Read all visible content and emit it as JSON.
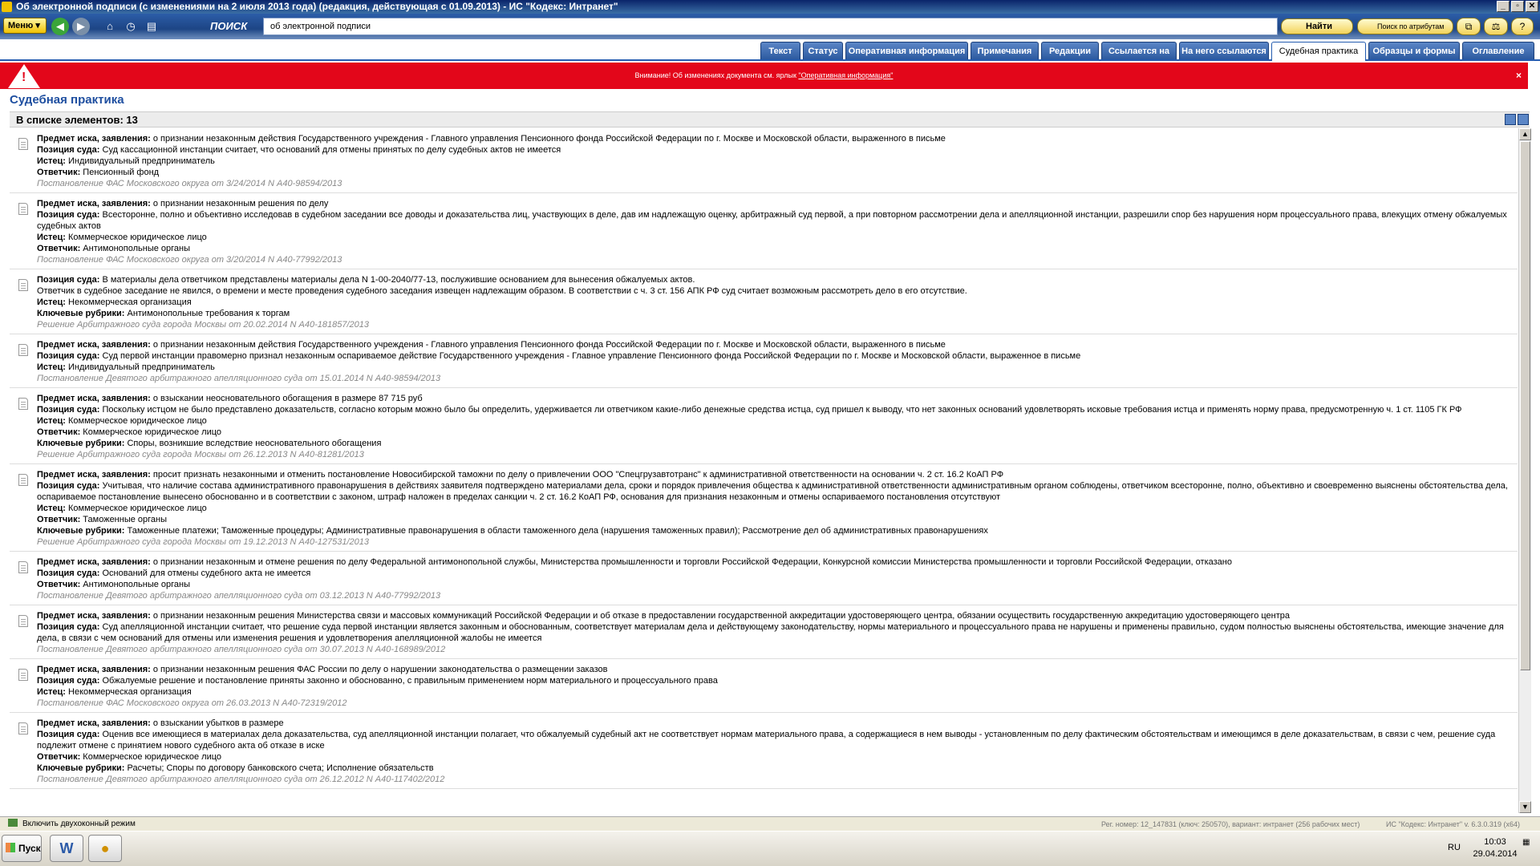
{
  "window": {
    "title": "Об электронной подписи (с изменениями на 2 июля 2013 года) (редакция, действующая с 01.09.2013) - ИС \"Кодекс: Интранет\"",
    "controls": [
      "_",
      "▫",
      "✕"
    ]
  },
  "toolbar": {
    "menu_label": "Меню",
    "search_label": "ПОИСК",
    "search_value": "об электронной подписи",
    "find_label": "Найти",
    "attr_search_label": "Поиск по атрибутам"
  },
  "tabs": [
    {
      "label": "Текст",
      "active": false
    },
    {
      "label": "Статус",
      "active": false
    },
    {
      "label": "Оперативная информация",
      "active": false
    },
    {
      "label": "Примечания",
      "active": false
    },
    {
      "label": "Редакции",
      "active": false
    },
    {
      "label": "Ссылается на",
      "active": false
    },
    {
      "label": "На него ссылаются",
      "active": false
    },
    {
      "label": "Судебная практика",
      "active": true
    },
    {
      "label": "Образцы и формы",
      "active": false
    },
    {
      "label": "Оглавление",
      "active": false
    }
  ],
  "alert": {
    "text": "Внимание! Об изменениях документа см. ярлык ",
    "link": "\"Оперативная информация\"",
    "close": "×"
  },
  "page": {
    "title": "Судебная практика",
    "count_label": "В списке элементов: 13"
  },
  "items": [
    {
      "lines": [
        {
          "label": "Предмет иска, заявления:",
          "text": " о признании незаконным действия Государственного учреждения - Главного управления Пенсионного фонда Российской Федерации по г. Москве и Московской области, выраженного в письме"
        },
        {
          "label": "Позиция суда:",
          "text": " Суд кассационной инстанции считает, что оснований для отмены принятых по делу судебных актов не имеется"
        },
        {
          "label": "Истец:",
          "text": " Индивидуальный предприниматель"
        },
        {
          "label": "Ответчик:",
          "text": " Пенсионный фонд"
        }
      ],
      "source": "Постановление ФАС Московского округа от 3/24/2014 N А40-98594/2013"
    },
    {
      "lines": [
        {
          "label": "Предмет иска, заявления:",
          "text": " о признании незаконным решения по делу"
        },
        {
          "label": "Позиция суда:",
          "text": " Всесторонне, полно и объективно исследовав в судебном заседании все доводы и доказательства лиц, участвующих в деле, дав им надлежащую оценку, арбитражный суд первой, а при повторном рассмотрении дела и апелляционной инстанции, разрешили спор без нарушения норм процессуального права, влекущих отмену обжалуемых судебных актов"
        },
        {
          "label": "Истец:",
          "text": " Коммерческое юридическое лицо"
        },
        {
          "label": "Ответчик:",
          "text": " Антимонопольные органы"
        }
      ],
      "source": "Постановление ФАС Московского округа от 3/20/2014 N А40-77992/2013"
    },
    {
      "lines": [
        {
          "label": "Позиция суда:",
          "text": " В материалы дела ответчиком представлены материалы дела N 1-00-2040/77-13, послужившие основанием для вынесения обжалуемых актов."
        },
        {
          "label": "",
          "text": "Ответчик в судебное заседание не явился, о времени и месте проведения судебного заседания извещен надлежащим образом. В соответствии с ч. 3 ст. 156 АПК РФ суд считает возможным рассмотреть дело в его отсутствие."
        },
        {
          "label": "Истец:",
          "text": " Некоммерческая организация"
        },
        {
          "label": "Ключевые рубрики:",
          "text": " Антимонопольные требования к торгам"
        }
      ],
      "source": "Решение Арбитражного суда города Москвы от 20.02.2014 N А40-181857/2013"
    },
    {
      "lines": [
        {
          "label": "Предмет иска, заявления:",
          "text": " о признании незаконным действия Государственного учреждения - Главного управления Пенсионного фонда Российской Федерации по г. Москве и Московской области, выраженного в письме"
        },
        {
          "label": "Позиция суда:",
          "text": " Суд первой инстанции правомерно признал незаконным оспариваемое действие Государственного учреждения - Главное управление Пенсионного фонда Российской Федерации по г. Москве и Московской области, выраженное в письме"
        },
        {
          "label": "Истец:",
          "text": " Индивидуальный предприниматель"
        }
      ],
      "source": "Постановление Девятого арбитражного апелляционного суда от 15.01.2014 N А40-98594/2013"
    },
    {
      "lines": [
        {
          "label": "Предмет иска, заявления:",
          "text": " о взыскании неосновательного обогащения в размере 87 715 руб"
        },
        {
          "label": "Позиция суда:",
          "text": " Поскольку истцом не было представлено доказательств, согласно которым можно было бы определить, удерживается ли ответчиком какие-либо денежные средства истца, суд пришел к выводу, что нет законных оснований удовлетворять исковые требования истца и применять норму права, предусмотренную ч. 1 ст. 1105 ГК РФ"
        },
        {
          "label": "Истец:",
          "text": " Коммерческое юридическое лицо"
        },
        {
          "label": "Ответчик:",
          "text": " Коммерческое юридическое лицо"
        },
        {
          "label": "Ключевые рубрики:",
          "text": " Споры, возникшие вследствие неосновательного обогащения"
        }
      ],
      "source": "Решение Арбитражного суда города Москвы от 26.12.2013 N А40-81281/2013"
    },
    {
      "lines": [
        {
          "label": "Предмет иска, заявления:",
          "text": " просит признать незаконными и отменить постановление Новосибирской таможни по делу о привлечении ООО \"Спецгрузавтотранс\" к административной ответственности на основании ч. 2 ст. 16.2 КоАП РФ"
        },
        {
          "label": "Позиция суда:",
          "text": " Учитывая, что наличие состава административного правонарушения в действиях заявителя подтверждено материалами дела, сроки и порядок привлечения общества к административной ответственности административным органом соблюдены, ответчиком всесторонне, полно, объективно и своевременно выяснены обстоятельства дела, оспариваемое постановление вынесено обоснованно и в соответствии с законом, штраф наложен в пределах санкции ч. 2 ст. 16.2 КоАП РФ, основания для признания незаконным и отмены оспариваемого постановления отсутствуют"
        },
        {
          "label": "Истец:",
          "text": " Коммерческое юридическое лицо"
        },
        {
          "label": "Ответчик:",
          "text": " Таможенные органы"
        },
        {
          "label": "Ключевые рубрики:",
          "text": " Таможенные платежи; Таможенные процедуры; Административные правонарушения в области таможенного дела (нарушения таможенных правил); Рассмотрение дел об административных правонарушениях"
        }
      ],
      "source": "Решение Арбитражного суда города Москвы от 19.12.2013 N А40-127531/2013"
    },
    {
      "lines": [
        {
          "label": "Предмет иска, заявления:",
          "text": " о признании незаконным и отмене решения по делу Федеральной антимонопольной службы, Министерства промышленности и торговли Российской Федерации, Конкурсной комиссии Министерства промышленности и торговли Российской Федерации, отказано"
        },
        {
          "label": "Позиция суда:",
          "text": " Оснований для отмены судебного акта не имеется"
        },
        {
          "label": "Ответчик:",
          "text": " Антимонопольные органы"
        }
      ],
      "source": "Постановление Девятого арбитражного апелляционного суда от 03.12.2013 N А40-77992/2013"
    },
    {
      "lines": [
        {
          "label": "Предмет иска, заявления:",
          "text": " о признании незаконным решения Министерства связи и массовых коммуникаций Российской Федерации и об отказе в предоставлении государственной аккредитации удостоверяющего центра, обязании осуществить государственную аккредитацию удостоверяющего центра"
        },
        {
          "label": "Позиция суда:",
          "text": " Суд апелляционной инстанции считает, что решение суда первой инстанции является законным и обоснованным, соответствует материалам дела и действующему законодательству, нормы материального и процессуального права не нарушены и применены правильно, судом полностью выяснены обстоятельства, имеющие значение для дела, в связи с чем оснований для отмены или изменения решения и удовлетворения апелляционной жалобы не имеется"
        }
      ],
      "source": "Постановление Девятого арбитражного апелляционного суда от 30.07.2013 N А40-168989/2012"
    },
    {
      "lines": [
        {
          "label": "Предмет иска, заявления:",
          "text": " о признании незаконным решения ФАС России по делу о нарушении законодательства о размещении заказов"
        },
        {
          "label": "Позиция суда:",
          "text": " Обжалуемые решение и постановление приняты законно и обоснованно, с правильным применением норм материального и процессуального права"
        },
        {
          "label": "Истец:",
          "text": " Некоммерческая организация"
        }
      ],
      "source": "Постановление ФАС Московского округа от 26.03.2013 N А40-72319/2012"
    },
    {
      "lines": [
        {
          "label": "Предмет иска, заявления:",
          "text": " о взыскании убытков в размере"
        },
        {
          "label": "Позиция суда:",
          "text": " Оценив все имеющиеся в материалах дела доказательства, суд апелляционной инстанции полагает, что обжалуемый судебный акт не соответствует нормам материального права, а содержащиеся в нем выводы - установленным по делу фактическим обстоятельствам и имеющимся в деле доказательствам, в связи с чем, решение суда подлежит отмене с принятием нового судебного акта об отказе в иске"
        },
        {
          "label": "Ответчик:",
          "text": " Коммерческое юридическое лицо"
        },
        {
          "label": "Ключевые рубрики:",
          "text": " Расчеты; Споры по договору банковского счета; Исполнение обязательств"
        }
      ],
      "source": "Постановление Девятого арбитражного апелляционного суда от 26.12.2012 N А40-117402/2012"
    }
  ],
  "statusbar": {
    "left": "Включить двухоконный режим",
    "reg": "Рег. номер: 12_147831 (ключ: 250570), вариант: интранет (256 рабочих мест)",
    "version": "ИС \"Кодекс: Интранет\" v. 6.3.0.319 (x64)"
  },
  "taskbar": {
    "start": "Пуск",
    "word_icon": "W",
    "lang": "RU",
    "time": "10:03",
    "date": "29.04.2014"
  }
}
